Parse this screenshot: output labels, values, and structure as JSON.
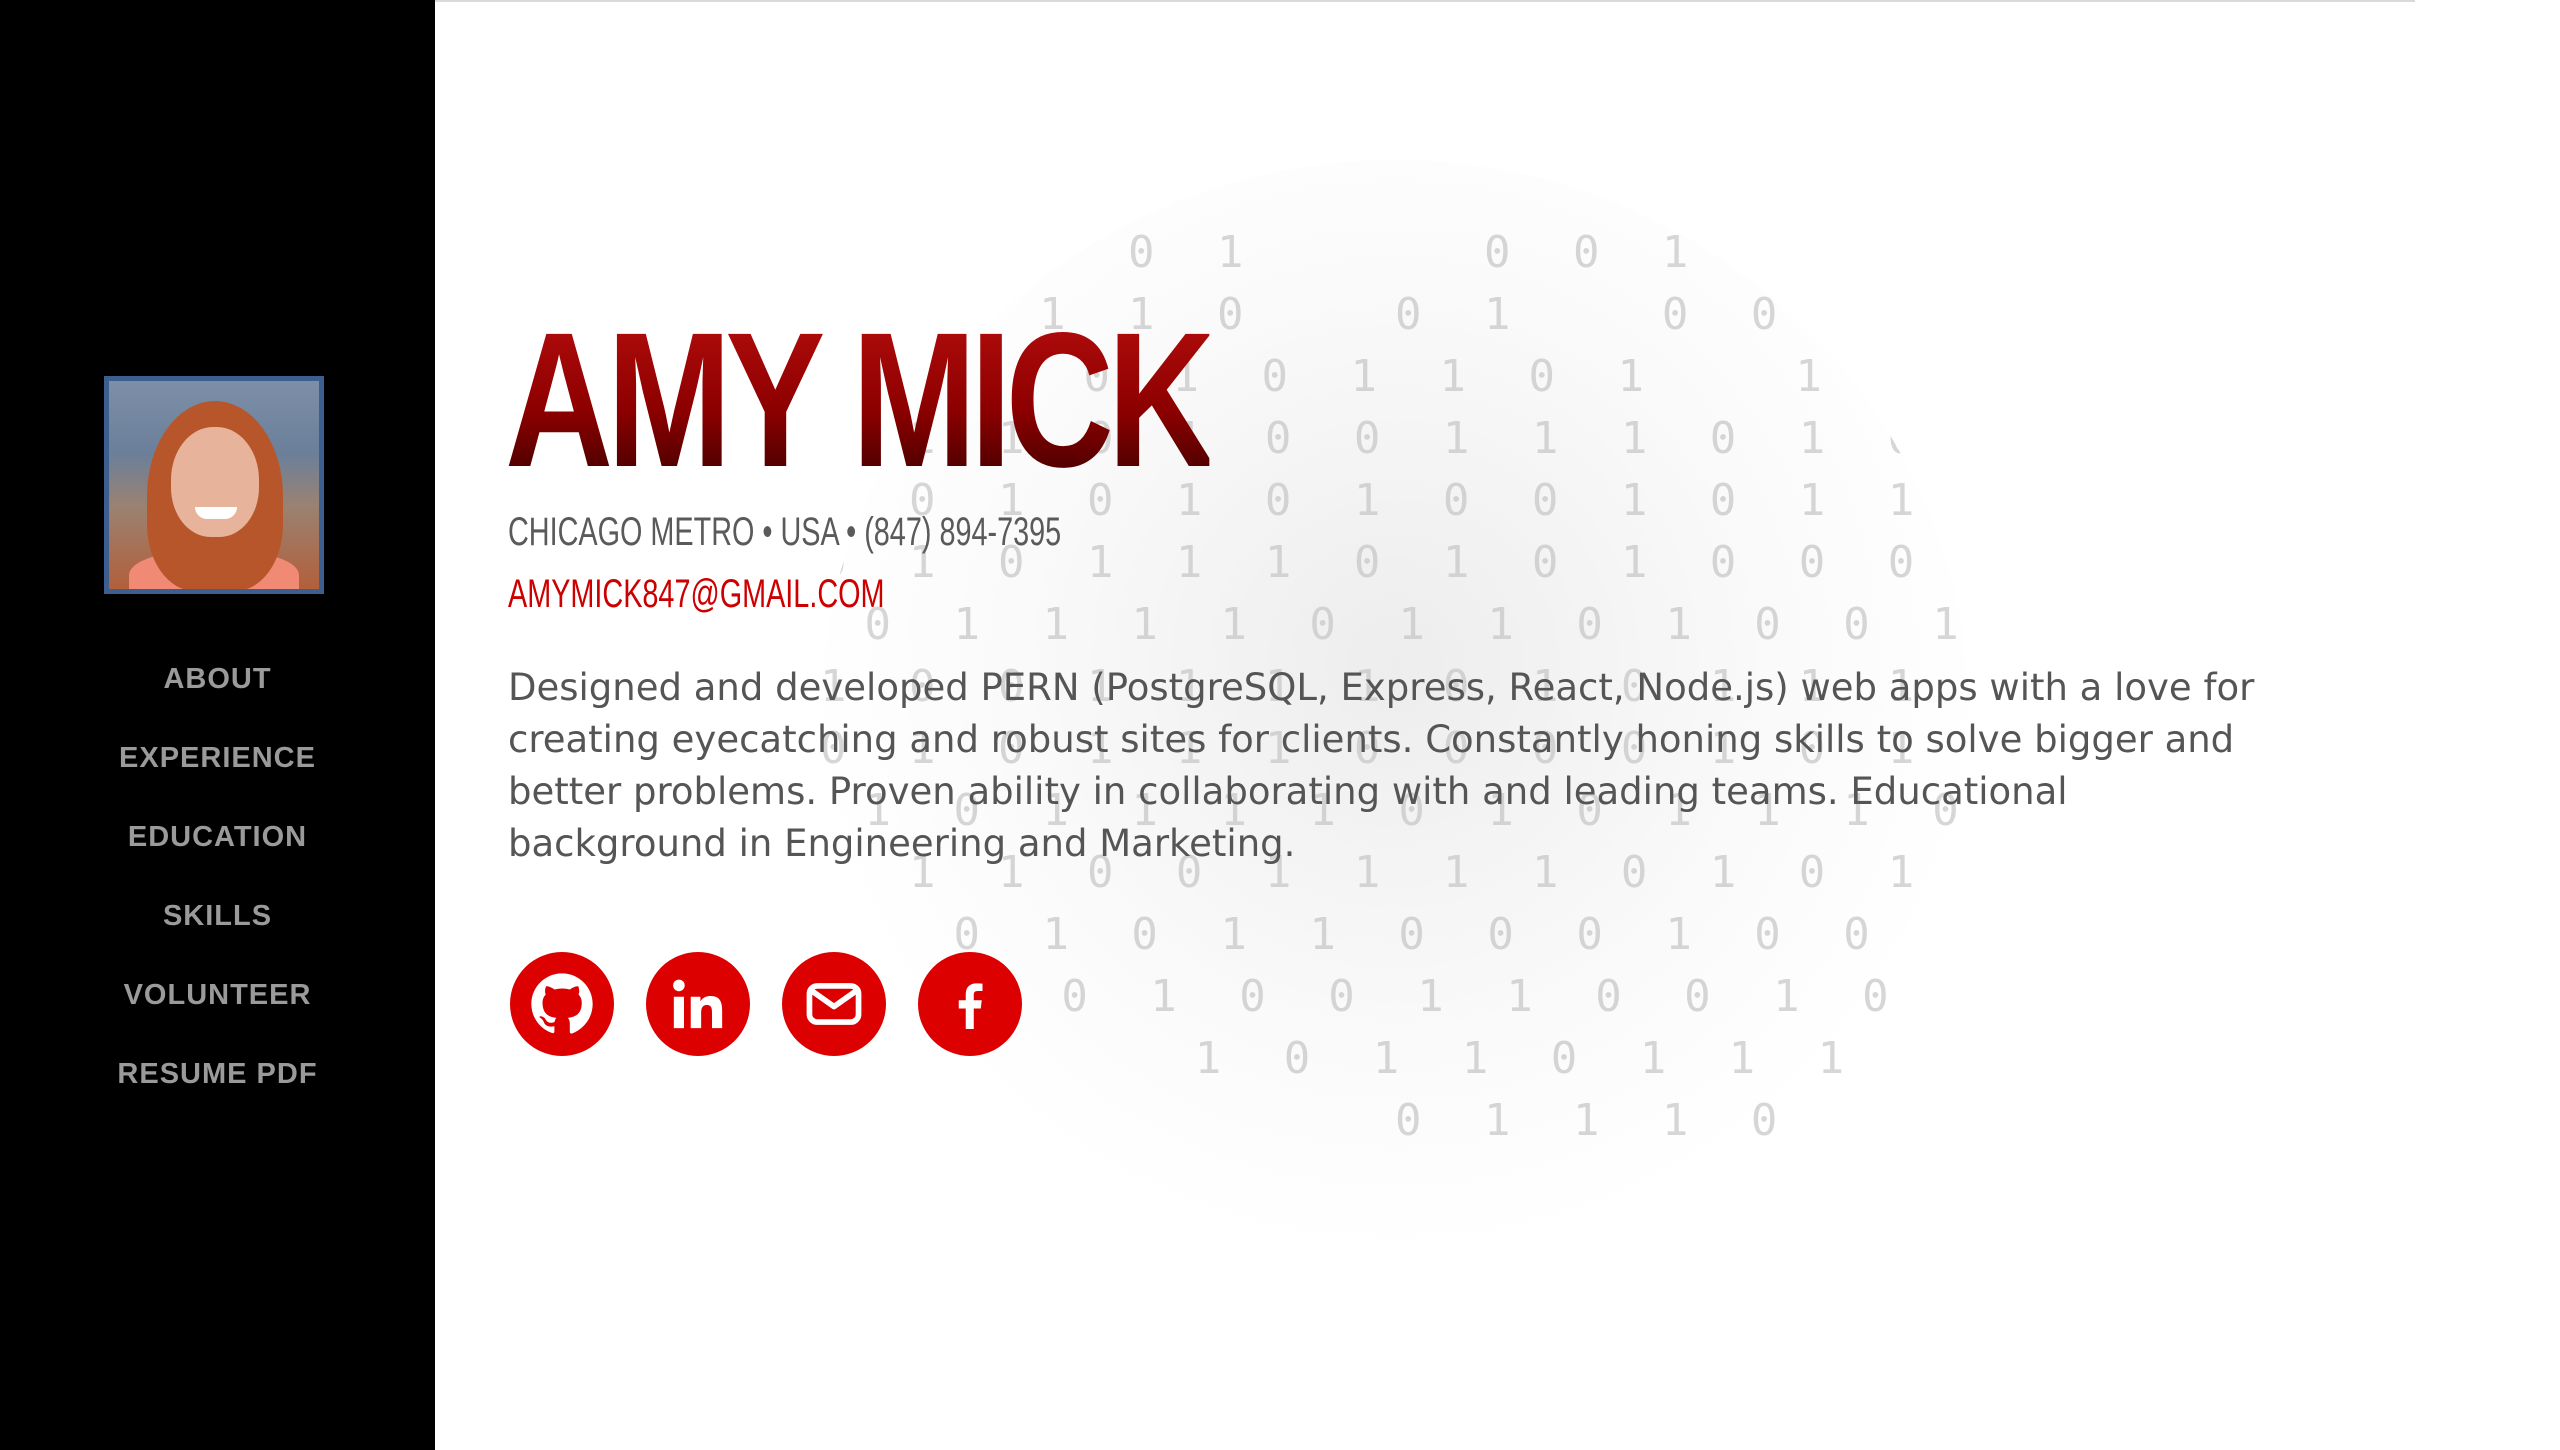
{
  "profile": {
    "name": "AMY MICK",
    "contact_line": "CHICAGO METRO • USA • (847) 894-7395",
    "email": "AMYMICK847@GMAIL.COM",
    "bio": "Designed and developed PERN (PostgreSQL, Express, React, Node.js) web apps with a love for creating eyecatching and robust sites for clients. Constantly honing skills to solve bigger and better problems. Proven ability in collaborating with and leading teams. Educational background in Engineering and Marketing."
  },
  "sidebar": {
    "nav": [
      {
        "label": "ABOUT"
      },
      {
        "label": "EXPERIENCE"
      },
      {
        "label": "EDUCATION"
      },
      {
        "label": "SKILLS"
      },
      {
        "label": "VOLUNTEER"
      },
      {
        "label": "RESUME PDF"
      }
    ]
  },
  "socials": [
    {
      "icon": "github-icon"
    },
    {
      "icon": "linkedin-icon"
    },
    {
      "icon": "envelope-icon"
    },
    {
      "icon": "facebook-icon"
    }
  ],
  "colors": {
    "sidebar_bg": "#000000",
    "accent_red": "#dd0000",
    "name_red": "#8f0000",
    "nav_text": "#9a9a9a"
  }
}
